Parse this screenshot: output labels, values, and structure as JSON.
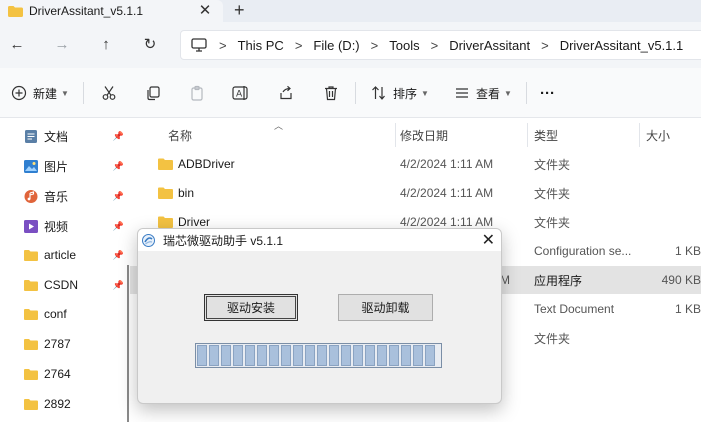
{
  "tab": {
    "title": "DriverAssitant_v5.1.1",
    "close": "✕",
    "add": "+"
  },
  "nav": {
    "back": "←",
    "forward": "→",
    "up": "↑",
    "refresh": "↻"
  },
  "breadcrumb": [
    "This PC",
    "File (D:)",
    "Tools",
    "DriverAssitant",
    "DriverAssitant_v5.1.1"
  ],
  "breadcrumb_sep": ">",
  "commands": {
    "new_label": "新建",
    "sort_label": "排序",
    "view_label": "查看",
    "more": "···"
  },
  "sidebar": {
    "items": [
      {
        "label": "文档",
        "icon": "document-icon",
        "pinned": true
      },
      {
        "label": "图片",
        "icon": "pictures-icon",
        "pinned": true
      },
      {
        "label": "音乐",
        "icon": "music-icon",
        "pinned": true
      },
      {
        "label": "视频",
        "icon": "video-icon",
        "pinned": true
      },
      {
        "label": "article",
        "icon": "folder-icon",
        "pinned": true
      },
      {
        "label": "CSDN",
        "icon": "folder-icon",
        "pinned": true
      },
      {
        "label": "conf",
        "icon": "folder-icon",
        "pinned": false
      },
      {
        "label": "2787",
        "icon": "folder-icon",
        "pinned": false
      },
      {
        "label": "2764",
        "icon": "folder-icon",
        "pinned": false
      },
      {
        "label": "2892",
        "icon": "folder-icon",
        "pinned": false
      }
    ]
  },
  "columns": {
    "name": "名称",
    "date": "修改日期",
    "type": "类型",
    "size": "大小"
  },
  "files": [
    {
      "name": "ADBDriver",
      "date": "4/2/2024 1:11 AM",
      "type": "文件夹",
      "size": "",
      "folder": true
    },
    {
      "name": "bin",
      "date": "4/2/2024 1:11 AM",
      "type": "文件夹",
      "size": "",
      "folder": true
    },
    {
      "name": "Driver",
      "date": "4/2/2024 1:11 AM",
      "type": "文件夹",
      "size": "",
      "folder": true
    },
    {
      "name": "",
      "date": "",
      "type": "Configuration se...",
      "size": "1 KB",
      "folder": false
    },
    {
      "name": "",
      "date": "M",
      "type": "应用程序",
      "size": "490 KB",
      "folder": false
    },
    {
      "name": "",
      "date": "",
      "type": "Text Document",
      "size": "1 KB",
      "folder": false
    },
    {
      "name": "",
      "date": "",
      "type": "文件夹",
      "size": "",
      "folder": false
    }
  ],
  "dialog": {
    "title": "瑞芯微驱动助手 v5.1.1",
    "install_label": "驱动安装",
    "uninstall_label": "驱动卸载",
    "close": "✕",
    "progress_percent": 100
  },
  "colors": {
    "folder": "#f3c242",
    "selection": "#e3e3e3",
    "progress_fill": "#a9c0dc"
  }
}
